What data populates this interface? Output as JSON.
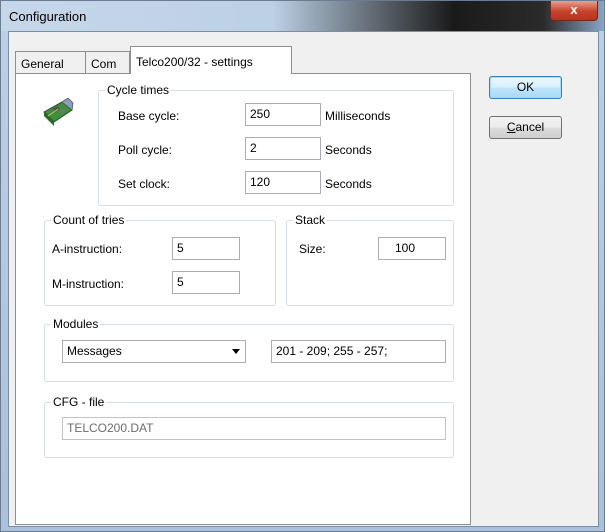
{
  "window": {
    "title": "Configuration",
    "close_glyph": "x"
  },
  "tabs": [
    {
      "label": "General",
      "active": false
    },
    {
      "label": "Com",
      "active": false
    },
    {
      "label": "Telco200/32 - settings",
      "active": true
    }
  ],
  "cycle_times": {
    "legend": "Cycle times",
    "icon": "network-card-icon",
    "rows": [
      {
        "label": "Base cycle:",
        "value": "250",
        "unit": "Milliseconds"
      },
      {
        "label": "Poll cycle:",
        "value": "2",
        "unit": "Seconds"
      },
      {
        "label": "Set clock:",
        "value": "120",
        "unit": "Seconds"
      }
    ]
  },
  "count_of_tries": {
    "legend": "Count of tries",
    "rows": [
      {
        "label": "A-instruction:",
        "value": "5"
      },
      {
        "label": "M-instruction:",
        "value": "5"
      }
    ]
  },
  "stack": {
    "legend": "Stack",
    "size_label": "Size:",
    "size_value": "100"
  },
  "modules": {
    "legend": "Modules",
    "selected": "Messages",
    "range": "201 - 209; 255 - 257;"
  },
  "cfg_file": {
    "legend": "CFG - file",
    "value": "TELCO200.DAT"
  },
  "buttons": {
    "ok": "OK",
    "cancel_first": "C",
    "cancel_rest": "ancel"
  }
}
